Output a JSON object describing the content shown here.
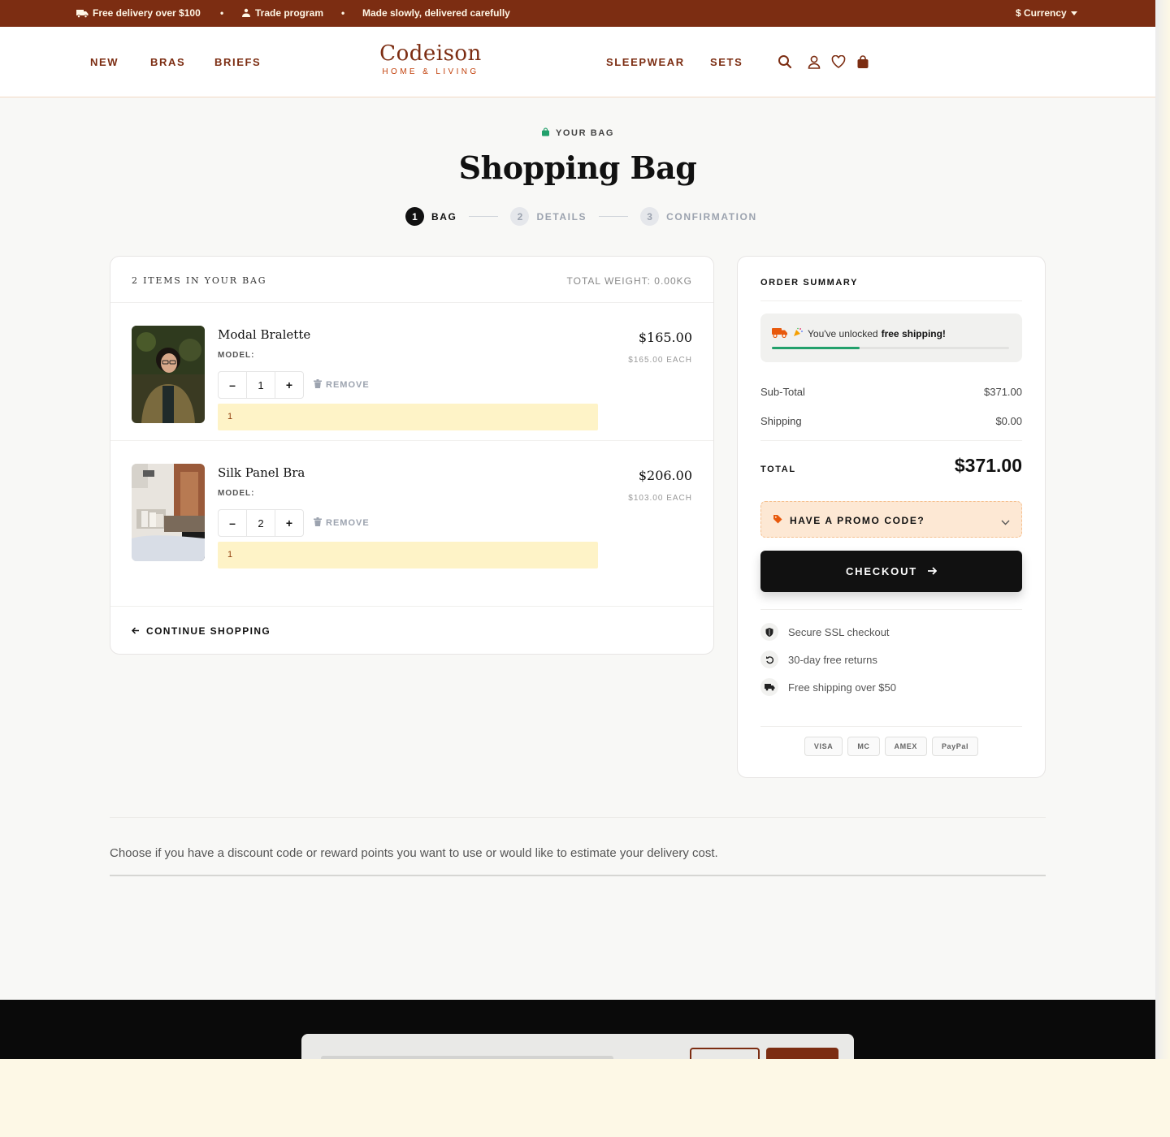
{
  "topbar": {
    "delivery": "Free delivery over $100",
    "trade": "Trade program",
    "made": "Made slowly, delivered carefully",
    "currency": "$ Currency"
  },
  "nav": {
    "new": "NEW",
    "bras": "BRAS",
    "briefs": "BRIEFS",
    "sleepwear": "SLEEPWEAR",
    "sets": "SETS"
  },
  "logo": {
    "name": "Codeison",
    "tagline": "HOME & LIVING"
  },
  "page": {
    "eyebrow": "YOUR BAG",
    "title": "Shopping Bag"
  },
  "steps": [
    {
      "num": "1",
      "label": "BAG"
    },
    {
      "num": "2",
      "label": "DETAILS"
    },
    {
      "num": "3",
      "label": "CONFIRMATION"
    }
  ],
  "bag": {
    "count": "2 ITEMS IN YOUR BAG",
    "weight": "TOTAL WEIGHT: 0.00KG",
    "remove_label": "REMOVE",
    "continue": "CONTINUE SHOPPING",
    "items": [
      {
        "name": "Modal Bralette",
        "model": "MODEL:",
        "qty": "1",
        "note": "1",
        "price": "$165.00",
        "each": "$165.00 EACH"
      },
      {
        "name": "Silk Panel Bra",
        "model": "MODEL:",
        "qty": "2",
        "note": "1",
        "price": "$206.00",
        "each": "$103.00 EACH"
      }
    ]
  },
  "summary": {
    "title": "ORDER SUMMARY",
    "shipping_msg": "You've unlocked",
    "shipping_msg_bold": "free shipping!",
    "shipping_progress": 0.37,
    "subtotal_label": "Sub-Total",
    "subtotal": "$371.00",
    "shipping_label": "Shipping",
    "shipping": "$0.00",
    "total_label": "TOTAL",
    "total": "$371.00",
    "promo": "HAVE A PROMO CODE?",
    "checkout": "CHECKOUT",
    "trust": [
      "Secure SSL checkout",
      "30-day free returns",
      "Free shipping over $50"
    ],
    "payments": [
      "VISA",
      "MC",
      "AMEX",
      "PayPal"
    ]
  },
  "lower": {
    "text": "Choose if you have a discount code or reward points you want to use or would like to estimate your delivery cost."
  },
  "colors": {
    "brand": "#7c2d12",
    "accent_green": "#22a06b",
    "promo_bg": "#fde8d4",
    "note_bg": "#fef3c7"
  }
}
